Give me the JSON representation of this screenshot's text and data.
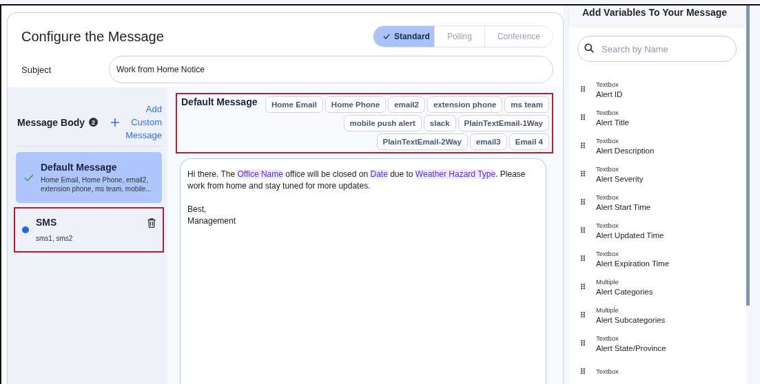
{
  "header": {
    "title": "Configure the Message",
    "modes": [
      {
        "label": "Standard",
        "selected": true
      },
      {
        "label": "Polling",
        "selected": false
      },
      {
        "label": "Conference",
        "selected": false
      }
    ]
  },
  "subject": {
    "label": "Subject",
    "value": "Work from Home Notice"
  },
  "message_body": {
    "title": "Message Body",
    "badge": "2",
    "add_button": "Add Custom Message",
    "items": [
      {
        "title": "Default Message",
        "recipients": "Home Email, Home Phone, email2, extension phone, ms team, mobile...",
        "selected": true,
        "highlighted": false,
        "deletable": false
      },
      {
        "title": "SMS",
        "recipients": "sms1, sms2",
        "selected": false,
        "highlighted": true,
        "deletable": true
      }
    ]
  },
  "editor": {
    "title": "Default Message",
    "highlighted": true,
    "channels": [
      "Home Email",
      "Home Phone",
      "email2",
      "extension phone",
      "ms team",
      "mobile push alert",
      "slack",
      "PlainTextEmail-1Way",
      "PlainTextEmail-2Way",
      "email3",
      "Email 4"
    ],
    "paragraphs": [
      {
        "lines": [
          [
            {
              "text": "Hi there. The "
            },
            {
              "text": "Office Name",
              "kind": "variable"
            },
            {
              "text": " office will be closed on "
            },
            {
              "text": "Date",
              "kind": "variable"
            },
            {
              "text": " due to "
            },
            {
              "text": "Weather Hazard Type",
              "kind": "variable"
            },
            {
              "text": ". Please work from home and stay tuned for more updates."
            }
          ]
        ]
      },
      {
        "lines": [
          [
            {
              "text": "Best,"
            }
          ],
          [
            {
              "text": "Management"
            }
          ]
        ]
      }
    ]
  },
  "variables": {
    "title": "Add Variables To Your Message",
    "search_placeholder": "Search by Name",
    "items": [
      {
        "type": "Textbox",
        "name": "Alert ID"
      },
      {
        "type": "Textbox",
        "name": "Alert Title"
      },
      {
        "type": "Textbox",
        "name": "Alert Description"
      },
      {
        "type": "Textbox",
        "name": "Alert Severity"
      },
      {
        "type": "Textbox",
        "name": "Alert Start Time"
      },
      {
        "type": "Textbox",
        "name": "Alert Updated Time"
      },
      {
        "type": "Textbox",
        "name": "Alert Expiration Time"
      },
      {
        "type": "Multiple",
        "name": "Alert Categories"
      },
      {
        "type": "Multiple",
        "name": "Alert Subcategories"
      },
      {
        "type": "Textbox",
        "name": "Alert State/Province"
      },
      {
        "type": "Textbox"
      }
    ]
  }
}
